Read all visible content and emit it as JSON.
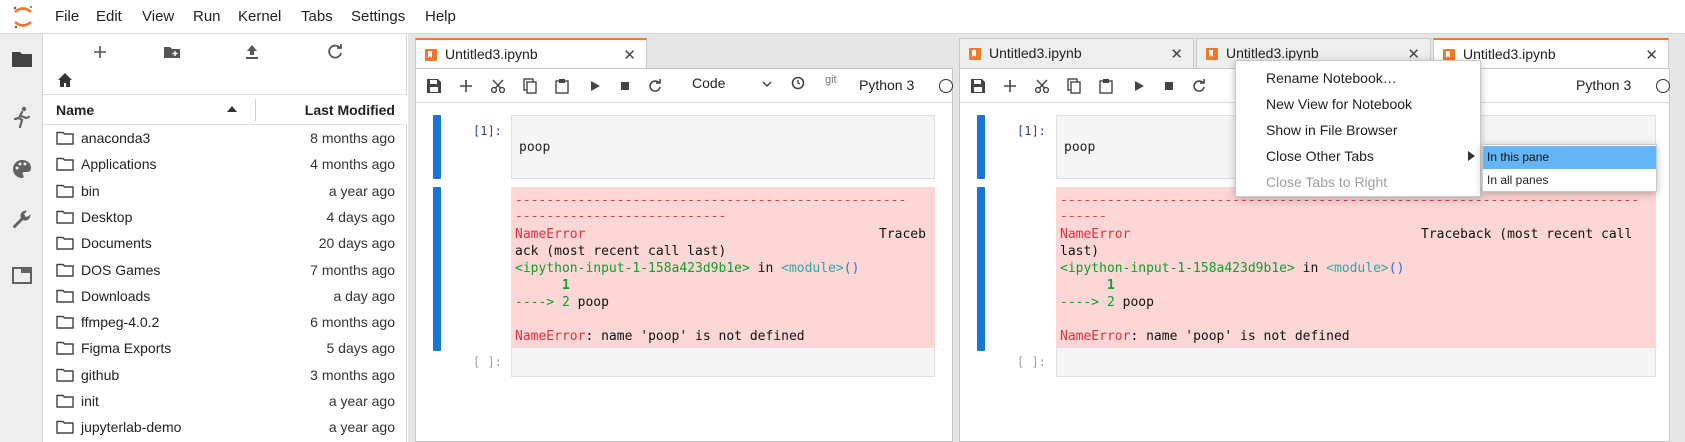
{
  "menubar": {
    "items": [
      "File",
      "Edit",
      "View",
      "Run",
      "Kernel",
      "Tabs",
      "Settings",
      "Help"
    ]
  },
  "file_browser": {
    "columns": {
      "name": "Name",
      "modified": "Last Modified"
    },
    "rows": [
      {
        "name": "anaconda3",
        "modified": "8 months ago"
      },
      {
        "name": "Applications",
        "modified": "4 months ago"
      },
      {
        "name": "bin",
        "modified": "a year ago"
      },
      {
        "name": "Desktop",
        "modified": "4 days ago"
      },
      {
        "name": "Documents",
        "modified": "20 days ago"
      },
      {
        "name": "DOS Games",
        "modified": "7 months ago"
      },
      {
        "name": "Downloads",
        "modified": "a day ago"
      },
      {
        "name": "ffmpeg-4.0.2",
        "modified": "6 months ago"
      },
      {
        "name": "Figma Exports",
        "modified": "5 days ago"
      },
      {
        "name": "github",
        "modified": "3 months ago"
      },
      {
        "name": "init",
        "modified": "a year ago"
      },
      {
        "name": "jupyterlab-demo",
        "modified": "a year ago"
      }
    ]
  },
  "tabs": {
    "left": [
      {
        "label": "Untitled3.ipynb",
        "close": "✕"
      }
    ],
    "right": [
      {
        "label": "Untitled3.ipynb",
        "close": "✕"
      },
      {
        "label": "Untitled3.ipynb",
        "close": "✕"
      },
      {
        "label": "Untitled3.ipynb",
        "close": "✕"
      }
    ]
  },
  "notebook_toolbar": {
    "cell_type": "Code",
    "git": "git",
    "kernel": "Python 3"
  },
  "notebook": {
    "prompt_1": "[1]:",
    "prompt_empty": "[ ]:",
    "code_1": "poop",
    "left_output": {
      "dashes_1": "--------------------------------------------------",
      "dashes_2": "---------------------------",
      "err_name": "NameError",
      "traceback_a": "Traceb",
      "traceback_b": "ack (most recent call last)",
      "input_ref": "<ipython-input-1-158a423d9b1e>",
      "in_word": " in ",
      "module": "<module>",
      "parens": "()",
      "line1_num": "      1",
      "arrow": "----> 2",
      "arrow_code": " poop",
      "final_err": "NameError",
      "final_msg": ": name 'poop' is not defined"
    },
    "right_output": {
      "dashes_1": "--------------------------------------------------------------------------",
      "dashes_2": "------",
      "err_name": "NameError",
      "traceback_a": "Traceback (most recent call",
      "traceback_b": "last)",
      "input_ref": "<ipython-input-1-158a423d9b1e>",
      "in_word": " in ",
      "module": "<module>",
      "parens": "()",
      "line1_num": "      1",
      "arrow": "----> 2",
      "arrow_code": " poop",
      "final_err": "NameError",
      "final_msg": ": name 'poop' is not defined"
    }
  },
  "context_menu": {
    "items": [
      {
        "label": "Rename Notebook…",
        "disabled": false
      },
      {
        "label": "New View for Notebook",
        "disabled": false
      },
      {
        "label": "Show in File Browser",
        "disabled": false
      },
      {
        "label": "Close Other Tabs",
        "disabled": false
      },
      {
        "label": "Close Tabs to Right",
        "disabled": true
      }
    ],
    "submenu": [
      {
        "label": "In this pane",
        "highlighted": true
      },
      {
        "label": "In all panes",
        "highlighted": false
      }
    ]
  },
  "colors": {
    "accent": "#f37726",
    "cell_bar": "#1976d2",
    "error_bg": "#fdd6d6",
    "highlight": "#64b5f6"
  }
}
